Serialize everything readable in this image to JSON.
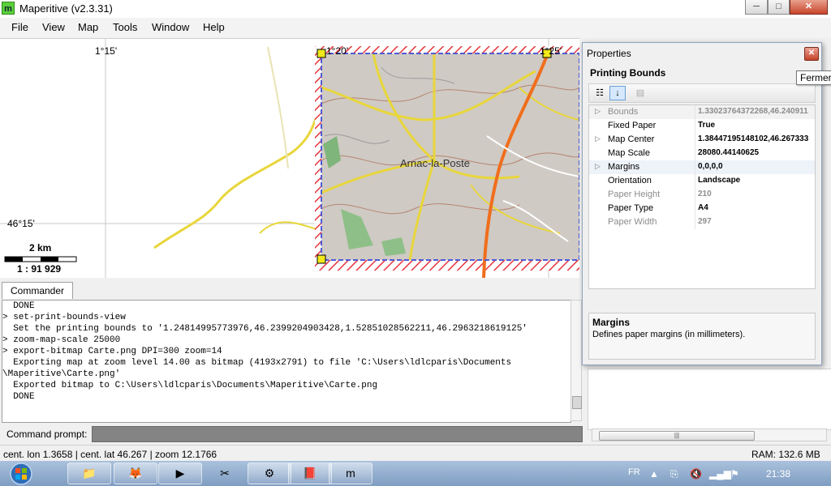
{
  "window": {
    "title": "Maperitive (v2.3.31)",
    "app_icon_letter": "m",
    "controls": {
      "minimize": "─",
      "maximize": "□",
      "close": "✕"
    }
  },
  "menu": [
    "File",
    "View",
    "Map",
    "Tools",
    "Window",
    "Help"
  ],
  "map": {
    "lon_label_1": "1°15'",
    "lon_label_2": "1°25'",
    "lon_label_3": "1°20'",
    "lat_label": "46°15'",
    "town": "Arnac-la-Poste",
    "scale_distance": "2 km",
    "scale_ratio": "1 : 91 929",
    "colors": {
      "print_bounds": "#e8343c",
      "print_inner": "#4f5bd5",
      "road_major": "#f06e1c",
      "road": "#e8d63a",
      "terrain": "#c9c5c0"
    }
  },
  "commander": {
    "tab": "Commander",
    "lines": [
      "  DONE",
      "> set-print-bounds-view",
      "  Set the printing bounds to '1.24814995773976,46.2399204903428,1.52851028562211,46.2963218619125'",
      "> zoom-map-scale 25000",
      "> export-bitmap Carte.png DPI=300 zoom=14",
      "  Exporting map at zoom level 14.00 as bitmap (4193x2791) to file 'C:\\Users\\ldlcparis\\Documents",
      "\\Maperitive\\Carte.png'",
      "  Exported bitmap to C:\\Users\\ldlcparis\\Documents\\Maperitive\\Carte.png",
      "  DONE"
    ],
    "prompt_label": "Command prompt:",
    "prompt_value": ""
  },
  "status": {
    "position": "cent. lon 1.3658 | cent. lat 46.267 | zoom 12.1766",
    "ram": "RAM: 132.6 MB"
  },
  "properties": {
    "title": "Properties",
    "heading": "Printing Bounds",
    "close_tooltip": "Fermer",
    "rows": [
      {
        "name": "Bounds",
        "value": "1.33023764372268,46.240911",
        "expandable": true,
        "readonly": true
      },
      {
        "name": "Fixed Paper",
        "value": "True",
        "expandable": false,
        "readonly": false
      },
      {
        "name": "Map Center",
        "value": "1.38447195148102,46.267333",
        "expandable": true,
        "readonly": false
      },
      {
        "name": "Map Scale",
        "value": "28080.44140625",
        "expandable": false,
        "readonly": false
      },
      {
        "name": "Margins",
        "value": "0,0,0,0",
        "expandable": true,
        "readonly": false
      },
      {
        "name": "Orientation",
        "value": "Landscape",
        "expandable": false,
        "readonly": false
      },
      {
        "name": "Paper Height",
        "value": "210",
        "expandable": false,
        "readonly": true
      },
      {
        "name": "Paper Type",
        "value": "A4",
        "expandable": false,
        "readonly": false
      },
      {
        "name": "Paper Width",
        "value": "297",
        "expandable": false,
        "readonly": true
      }
    ],
    "desc_title": "Margins",
    "desc_text": "Defines paper margins (in millimeters)."
  },
  "taskbar": {
    "language": "FR",
    "time": "21:38"
  }
}
